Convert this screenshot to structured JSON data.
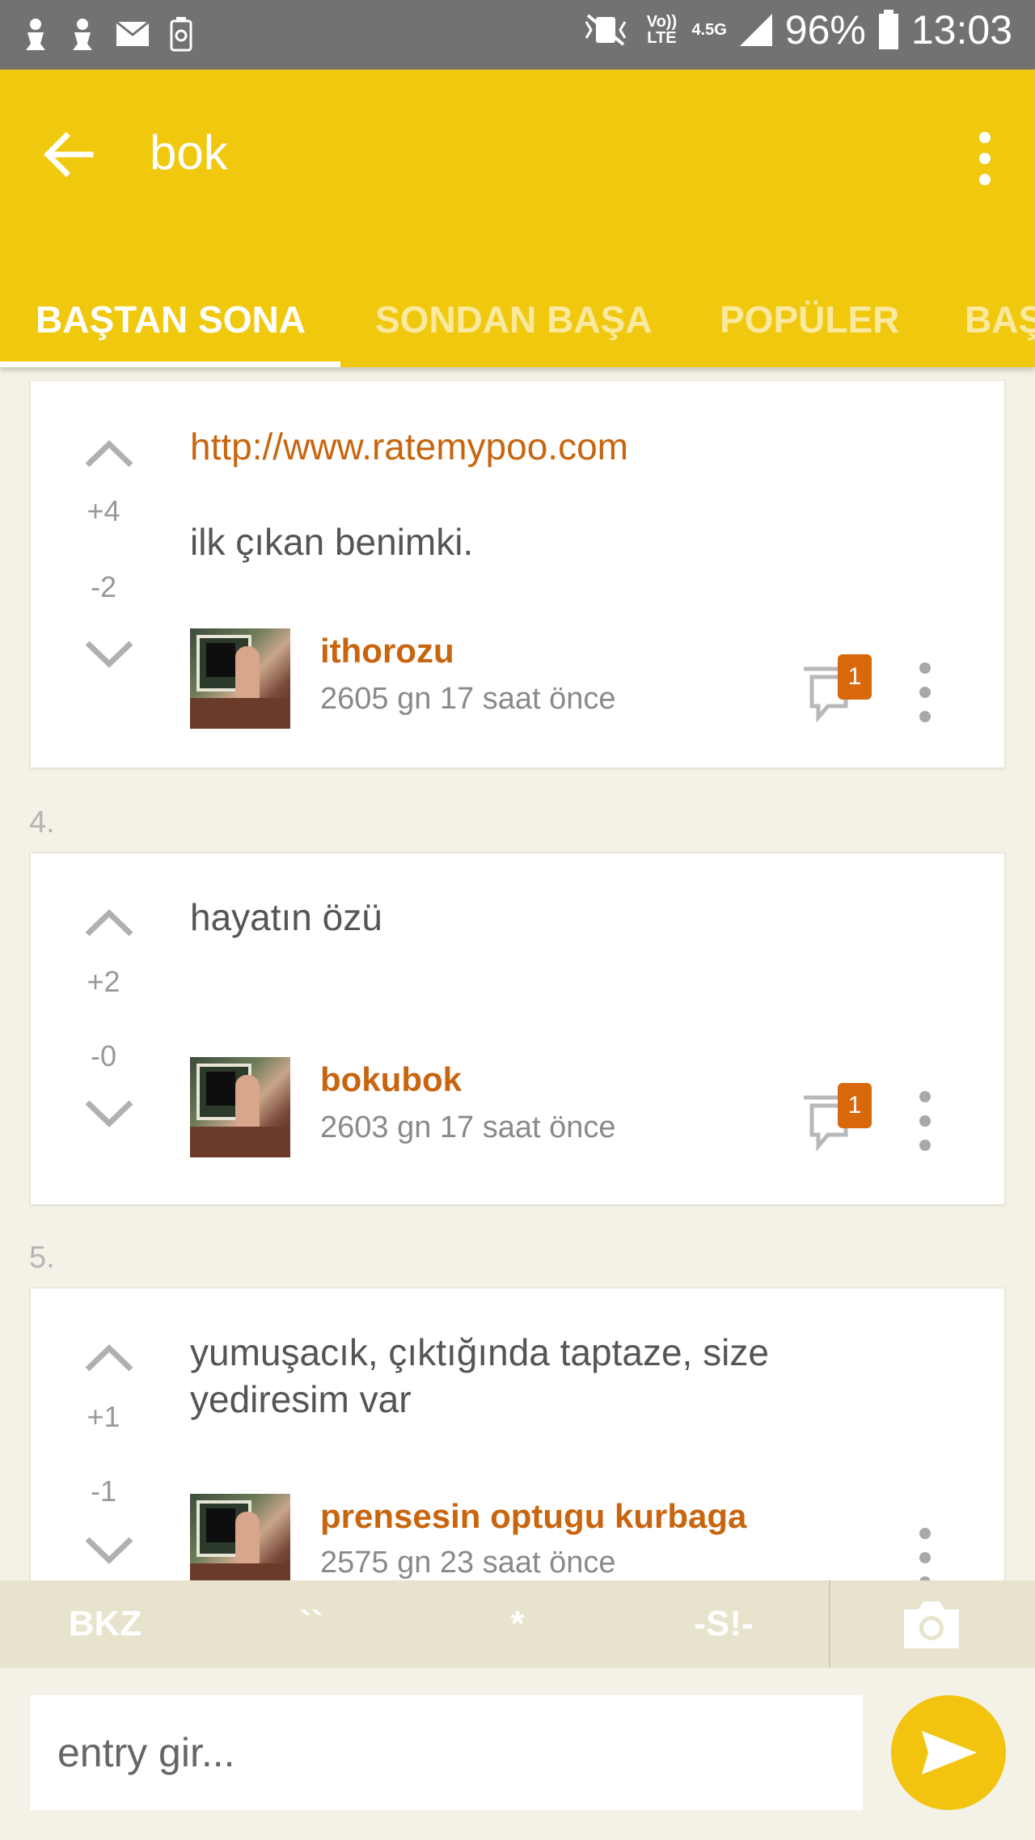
{
  "status_bar": {
    "network_volte": "Vo)) LTE",
    "network_type": "4.5G",
    "battery": "96%",
    "time": "13:03"
  },
  "app_bar": {
    "title": "bok",
    "color": "#f0c90f"
  },
  "tabs": [
    {
      "label": "BAŞTAN SONA",
      "active": true
    },
    {
      "label": "SONDAN BAŞA",
      "active": false
    },
    {
      "label": "POPÜLER",
      "active": false
    },
    {
      "label": "BAŞ",
      "active": false
    }
  ],
  "entries": [
    {
      "number": "",
      "link": "http://www.ratemypoo.com",
      "text": "ilk çıkan benimki.",
      "upvotes": "+4",
      "downvotes": "-2",
      "author": "ithorozu",
      "time": "2605 gn 17 saat  önce",
      "comments": "1"
    },
    {
      "number": "4.",
      "link": "",
      "text": "hayatın özü",
      "upvotes": "+2",
      "downvotes": "-0",
      "author": "bokubok",
      "time": "2603 gn 17 saat  önce",
      "comments": "1"
    },
    {
      "number": "5.",
      "link": "",
      "text": "yumuşacık, çıktığında taptaze, size yediresim var",
      "upvotes": "+1",
      "downvotes": "-1",
      "author": "prensesin optugu kurbaga",
      "time": "2575 gn 23 saat  önce",
      "comments": ""
    }
  ],
  "format_bar": {
    "bkz": "BKZ",
    "backticks": "``",
    "star": "*",
    "spoiler": "-S!-"
  },
  "input": {
    "placeholder": "entry gir..."
  },
  "colors": {
    "accent": "#f0c90f",
    "link": "#c8650e",
    "badge": "#d8680a",
    "background": "#f4f1e6"
  }
}
